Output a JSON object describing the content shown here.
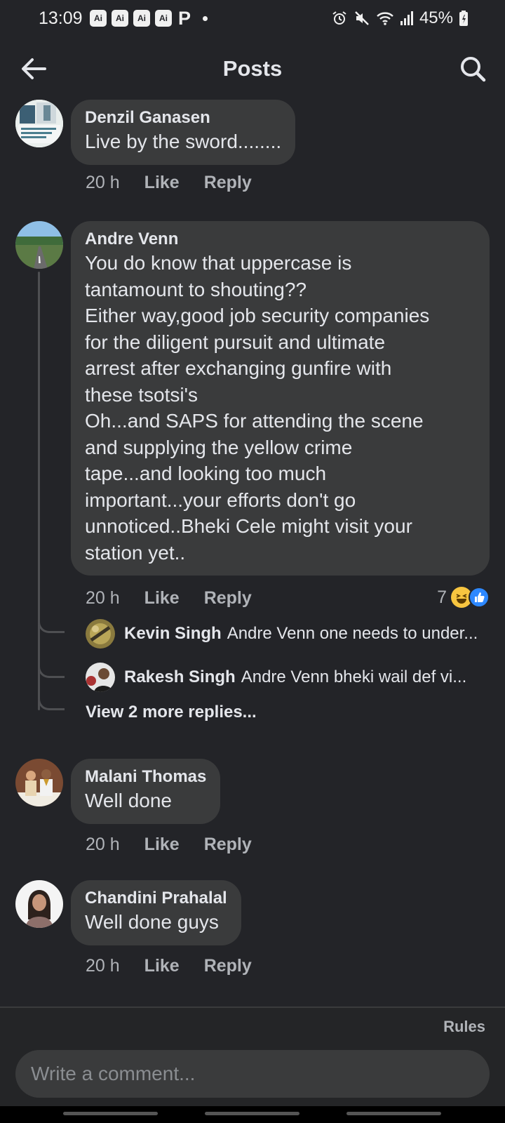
{
  "status_bar": {
    "time": "13:09",
    "badges": [
      "Ai",
      "Ai",
      "Ai",
      "Ai"
    ],
    "p_icon": "P",
    "battery": "45%",
    "icons": [
      "alarm-icon",
      "mute-icon",
      "wifi-icon",
      "signal-icon",
      "battery-icon"
    ]
  },
  "header": {
    "title": "Posts",
    "back_icon": "arrow-left-icon",
    "search_icon": "search-icon"
  },
  "comments": [
    {
      "author": "Denzil Ganasen",
      "text": "Live by the sword........",
      "time": "20 h",
      "like": "Like",
      "reply": "Reply"
    },
    {
      "author": "Andre Venn",
      "lines": [
        "You do know that uppercase is",
        "tantamount to shouting??",
        "Either way,good job security companies",
        "for the diligent pursuit and ultimate",
        "arrest after exchanging gunfire with",
        "these tsotsi's",
        "Oh...and SAPS for attending the scene",
        "and supplying the yellow crime",
        "tape...and looking too much",
        "important...your efforts don't go",
        "unnoticed..Bheki Cele might visit your",
        "station yet.."
      ],
      "time": "20 h",
      "like": "Like",
      "reply": "Reply",
      "reaction_count": "7",
      "reactions": [
        "laugh-emoji",
        "like-emoji"
      ],
      "replies": [
        {
          "author": "Kevin Singh",
          "snippet": "Andre Venn one needs to under..."
        },
        {
          "author": "Rakesh Singh",
          "snippet": "Andre Venn bheki  wail def  vi..."
        }
      ],
      "view_more": "View 2 more replies..."
    },
    {
      "author": "Malani Thomas",
      "text": "Well done",
      "time": "20 h",
      "like": "Like",
      "reply": "Reply"
    },
    {
      "author": "Chandini Prahalal",
      "text": "Well done guys",
      "time": "20 h",
      "like": "Like",
      "reply": "Reply"
    }
  ],
  "composer": {
    "rules": "Rules",
    "placeholder": "Write a comment..."
  }
}
